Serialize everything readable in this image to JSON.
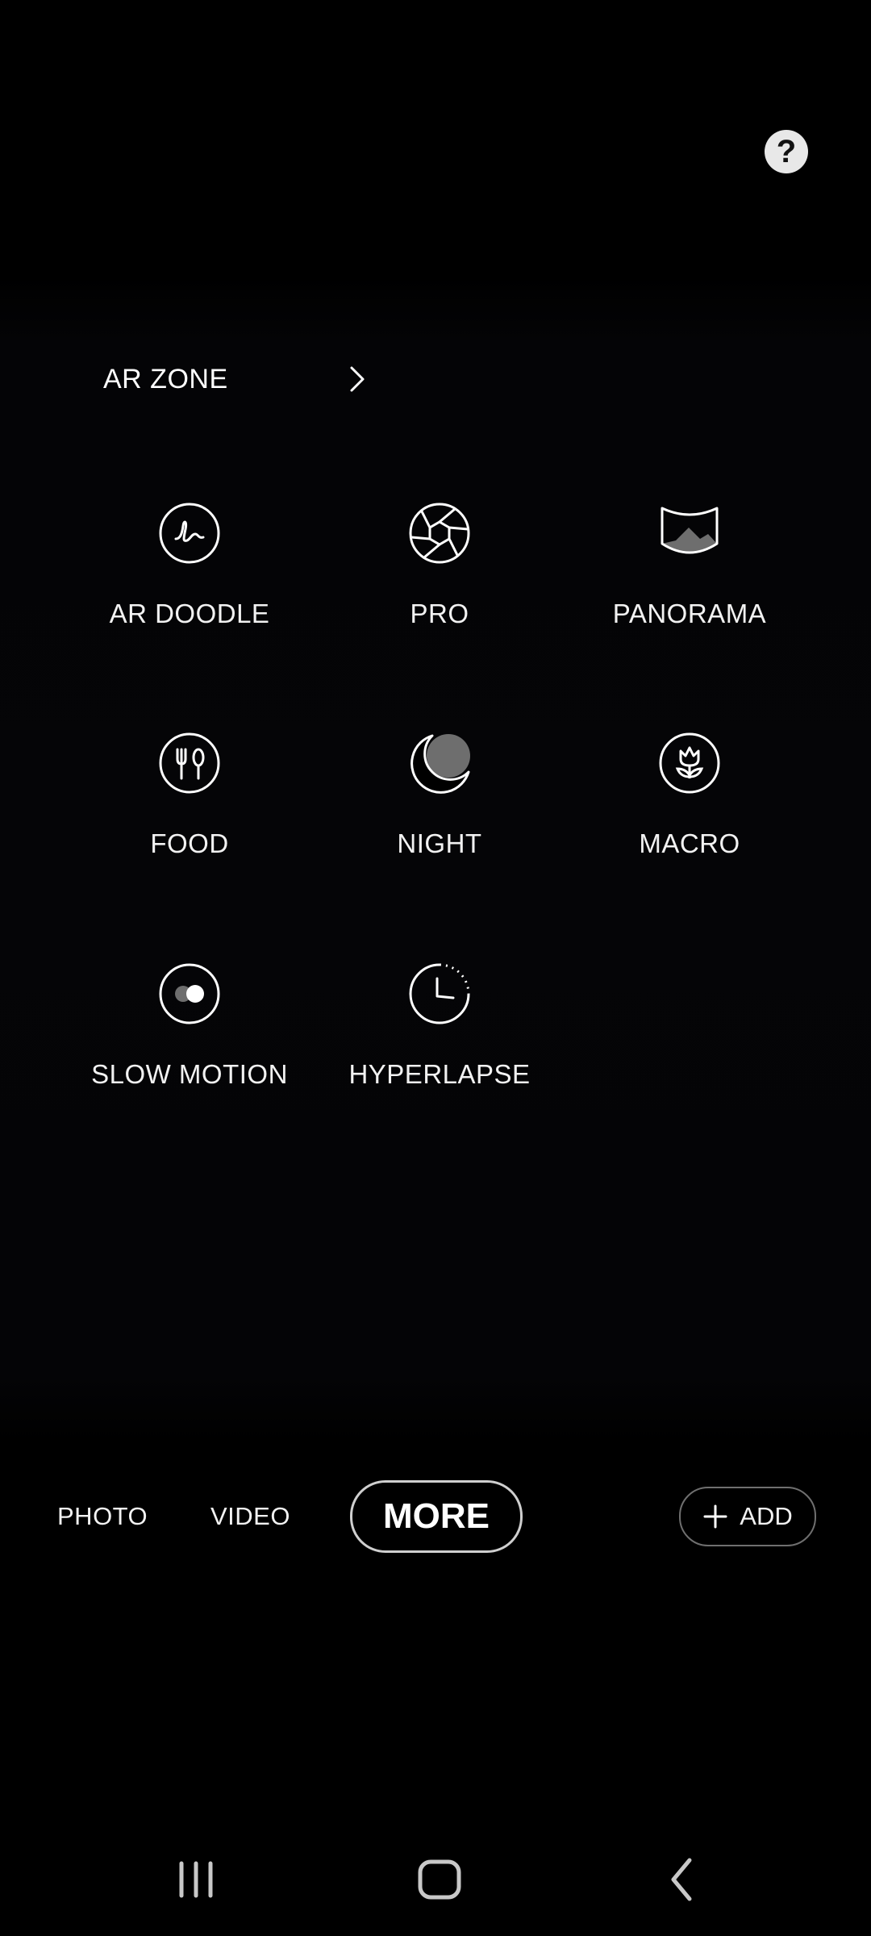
{
  "colors": {
    "background": "#000000",
    "text": "#f2f2f2",
    "icon_stroke": "#ffffff",
    "icon_fill_gray": "#6e6e6e",
    "help_bg": "#e8e8e8"
  },
  "help_button": {
    "label": "?",
    "icon": "help-icon"
  },
  "ar_zone": {
    "label": "AR ZONE",
    "icon": "chevron-right-icon"
  },
  "modes": [
    {
      "label": "AR DOODLE",
      "icon": "ar-doodle-icon"
    },
    {
      "label": "PRO",
      "icon": "aperture-icon"
    },
    {
      "label": "PANORAMA",
      "icon": "panorama-icon"
    },
    {
      "label": "FOOD",
      "icon": "food-icon"
    },
    {
      "label": "NIGHT",
      "icon": "moon-icon"
    },
    {
      "label": "MACRO",
      "icon": "flower-icon"
    },
    {
      "label": "SLOW MOTION",
      "icon": "slow-motion-icon"
    },
    {
      "label": "HYPERLAPSE",
      "icon": "timer-icon"
    }
  ],
  "mode_bar": {
    "tabs": [
      "PHOTO",
      "VIDEO",
      "MORE"
    ],
    "selected": "MORE",
    "add": {
      "label": "ADD",
      "icon": "plus-icon"
    }
  },
  "navigation_bar": {
    "buttons": [
      "recent-apps-icon",
      "home-icon",
      "back-icon"
    ]
  }
}
